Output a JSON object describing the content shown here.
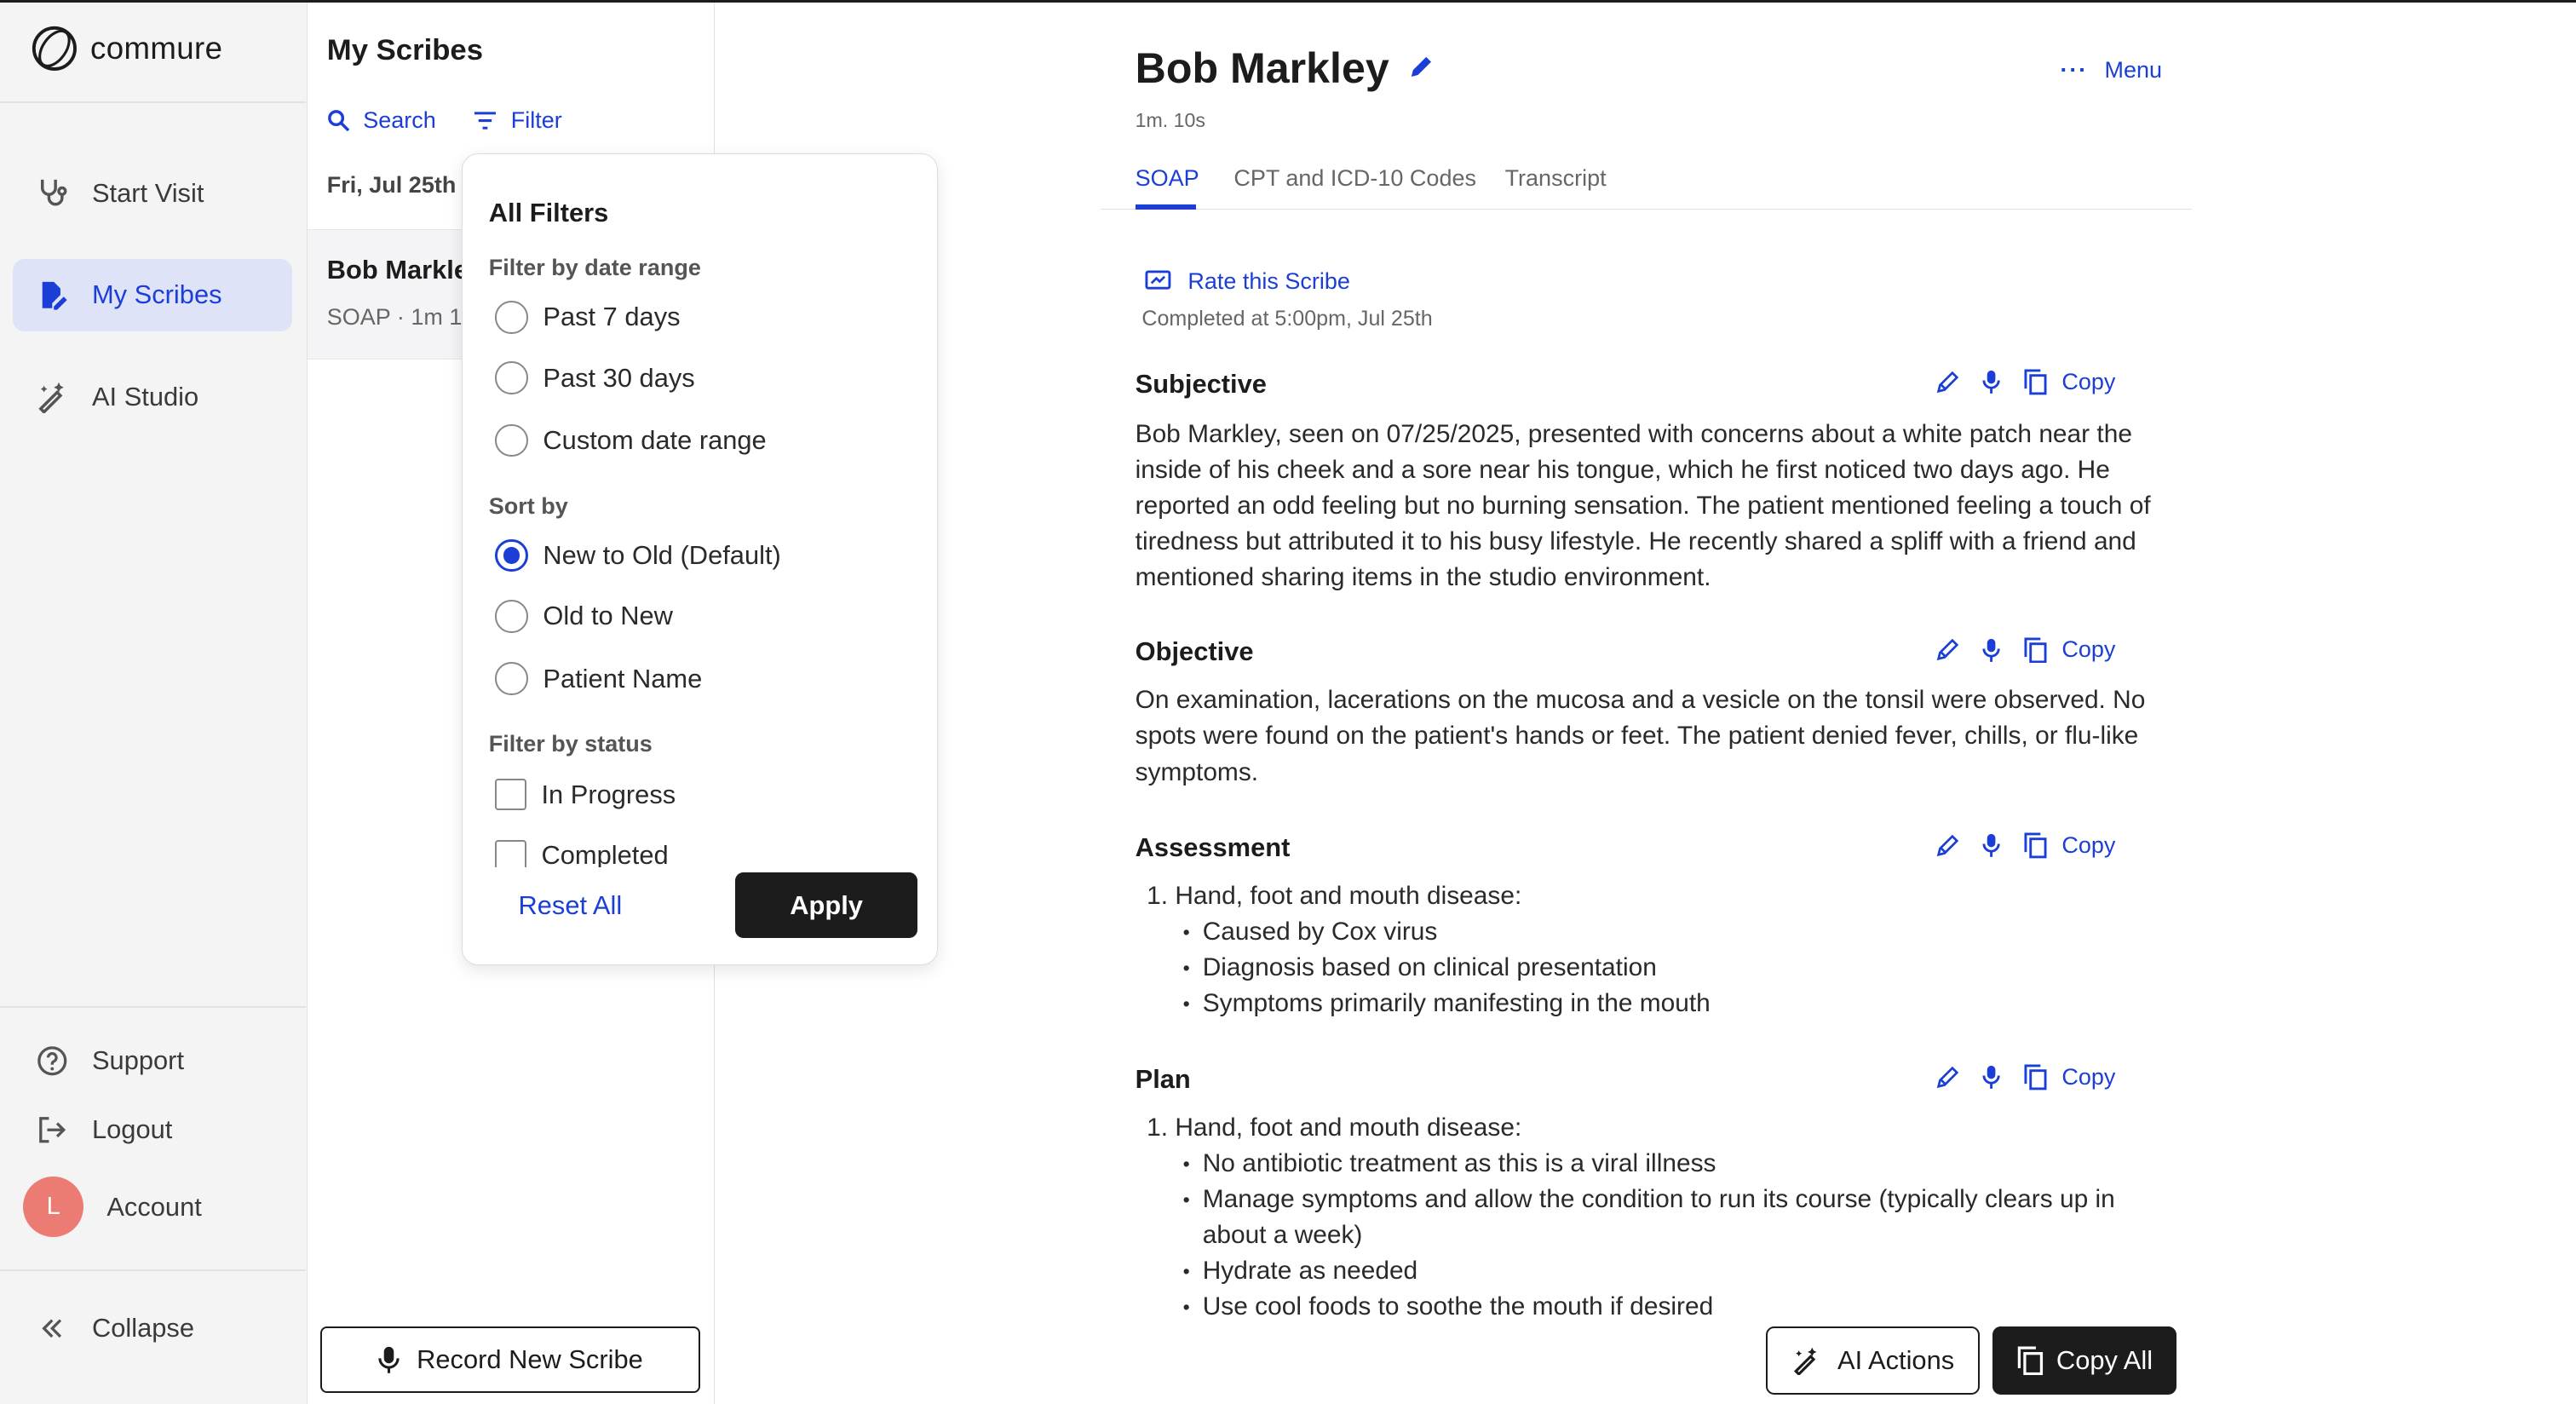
{
  "brand": {
    "name": "commure"
  },
  "nav": {
    "items": [
      {
        "label": "Start Visit",
        "icon": "stethoscope-icon"
      },
      {
        "label": "My Scribes",
        "icon": "document-edit-icon",
        "active": true
      },
      {
        "label": "AI Studio",
        "icon": "magic-wand-icon"
      }
    ],
    "support": "Support",
    "logout": "Logout",
    "account": {
      "label": "Account",
      "initial": "L"
    },
    "collapse": "Collapse"
  },
  "list": {
    "title": "My Scribes",
    "search": "Search",
    "filter": "Filter",
    "date_group": "Fri, Jul 25th (1)",
    "item": {
      "name": "Bob Markley",
      "type": "SOAP",
      "duration": "1m 10s"
    },
    "record_button": "Record New Scribe"
  },
  "filters": {
    "title": "All Filters",
    "date_range": {
      "label": "Filter by date range",
      "options": [
        "Past 7 days",
        "Past 30 days",
        "Custom date range"
      ]
    },
    "sort": {
      "label": "Sort by",
      "options": [
        "New to Old (Default)",
        "Old to New",
        "Patient Name"
      ],
      "selected": "New to Old (Default)"
    },
    "status": {
      "label": "Filter by status",
      "options": [
        "In Progress",
        "Completed"
      ]
    },
    "reset": "Reset All",
    "apply": "Apply"
  },
  "main": {
    "patient_name": "Bob Markley",
    "duration": "1m. 10s",
    "menu": "Menu",
    "tabs": [
      "SOAP",
      "CPT and ICD-10 Codes",
      "Transcript"
    ],
    "active_tab": "SOAP",
    "rate": "Rate this Scribe",
    "completed": "Completed at 5:00pm, Jul 25th",
    "copy_label": "Copy",
    "sections": {
      "subjective": {
        "title": "Subjective",
        "text": "Bob Markley, seen on 07/25/2025, presented with concerns about a white patch near the inside of his cheek and a sore near his tongue, which he first noticed two days ago. He reported an odd feeling but no burning sensation. The patient mentioned feeling a touch of tiredness but attributed it to his busy lifestyle. He recently shared a spliff with a friend and mentioned sharing items in the studio environment."
      },
      "objective": {
        "title": "Objective",
        "text": "On examination, lacerations on the mucosa and a vesicle on the tonsil were observed. No spots were found on the patient's hands or feet. The patient denied fever, chills, or flu-like symptoms."
      },
      "assessment": {
        "title": "Assessment",
        "heading": "1.  Hand, foot and mouth disease:",
        "bullets": [
          "Caused by Cox virus",
          "Diagnosis based on clinical presentation",
          "Symptoms primarily manifesting in the mouth"
        ]
      },
      "plan": {
        "title": "Plan",
        "heading": "1.  Hand, foot and mouth disease:",
        "bullets": [
          "No antibiotic treatment as this is a viral illness",
          "Manage symptoms and allow the condition to run its course (typically clears up in about a week)",
          "Hydrate as needed",
          "Use cool foods to soothe the mouth if desired"
        ]
      }
    },
    "ai_actions": "AI Actions",
    "copy_all": "Copy All"
  },
  "colors": {
    "accent": "#1b3fd6",
    "dark": "#1c1c1c",
    "nav_bg": "#f4f4f5",
    "active_bg": "#dfe3f8",
    "avatar": "#ec7c73"
  }
}
